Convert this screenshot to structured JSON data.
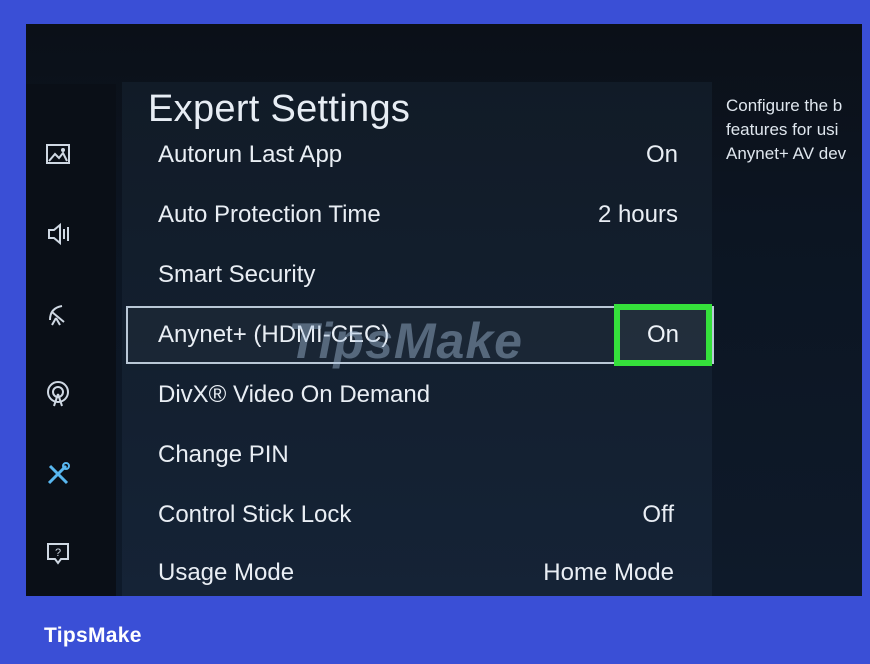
{
  "screen": {
    "title": "Expert Settings",
    "sidebar": [
      {
        "icon": "picture-icon"
      },
      {
        "icon": "sound-icon"
      },
      {
        "icon": "broadcast-icon"
      },
      {
        "icon": "network-icon"
      },
      {
        "icon": "general-tools-icon"
      },
      {
        "icon": "support-icon"
      }
    ],
    "rows": [
      {
        "label": "Autorun Last App",
        "value": "On"
      },
      {
        "label": "Auto Protection Time",
        "value": "2 hours"
      },
      {
        "label": "Smart Security",
        "value": ""
      },
      {
        "label": "Anynet+ (HDMI-CEC)",
        "value": "On"
      },
      {
        "label": "DivX® Video On Demand",
        "value": ""
      },
      {
        "label": "Change PIN",
        "value": ""
      },
      {
        "label": "Control Stick Lock",
        "value": "Off"
      },
      {
        "label": "Usage Mode",
        "value": "Home Mode"
      }
    ],
    "help_lines": [
      "Configure the b",
      "features for usi",
      "Anynet+ AV dev"
    ],
    "highlight_color": "#35e03b"
  },
  "watermark": "TipsMake",
  "footer": {
    "brand": "TipsMake"
  }
}
